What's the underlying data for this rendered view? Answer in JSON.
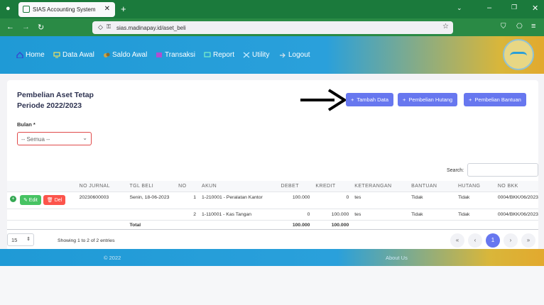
{
  "browser": {
    "tab_title": "SIAS Accounting System",
    "tab_close": "✕",
    "new_tab": "+",
    "url": "sias.madinapay.id/aset_beli"
  },
  "nav": {
    "items": [
      {
        "label": "Home",
        "icon": "home-icon"
      },
      {
        "label": "Data Awal",
        "icon": "monitor-icon"
      },
      {
        "label": "Saldo Awal",
        "icon": "coins-icon"
      },
      {
        "label": "Transaksi",
        "icon": "transaction-icon"
      },
      {
        "label": "Report",
        "icon": "report-icon"
      },
      {
        "label": "Utility",
        "icon": "tools-icon"
      },
      {
        "label": "Logout",
        "icon": "logout-icon"
      }
    ]
  },
  "page": {
    "title_line1": "Pembelian Aset Tetap",
    "title_line2": "Periode 2022/2023",
    "buttons": {
      "tambah": "Tambah Data",
      "hutang": "Pembelian Hutang",
      "bantuan": "Pembelian Bantuan"
    },
    "filter": {
      "label": "Bulan *",
      "selected": "-- Semua --"
    },
    "search_label": "Search:"
  },
  "table": {
    "headers": [
      "NO JURNAL",
      "TGL BELI",
      "NO",
      "AKUN",
      "DEBET",
      "KREDIT",
      "KETERANGAN",
      "BANTUAN",
      "HUTANG",
      "NO BKK"
    ],
    "edit_label": "Edit",
    "del_label": "Del",
    "rows": [
      {
        "no_jurnal": "20230600003",
        "tgl": "Senin, 18-06-2023",
        "no": "1",
        "akun": "1-210001 - Peralatan Kantor",
        "debet": "100.000",
        "kredit": "0",
        "ket": "tes",
        "bantuan": "Tidak",
        "hutang": "Tidak",
        "bkk": "0004/BKK/06/2023"
      },
      {
        "no_jurnal": "",
        "tgl": "",
        "no": "2",
        "akun": "1-110001 - Kas Tangan",
        "debet": "0",
        "kredit": "100.000",
        "ket": "tes",
        "bantuan": "Tidak",
        "hutang": "Tidak",
        "bkk": "0004/BKK/06/2023"
      }
    ],
    "total_label": "Total",
    "total_debet": "100.000",
    "total_kredit": "100.000"
  },
  "pagination": {
    "page_size": "15",
    "showing": "Showing 1 to 2 of 2 entries",
    "current": "1"
  },
  "footer": {
    "copyright": "© 2022",
    "right": "About Us"
  },
  "colors": {
    "accent": "#6777ef",
    "nav_start": "#1f9ad6",
    "nav_end": "#e2a92e",
    "browser": "#1b7a3c"
  }
}
